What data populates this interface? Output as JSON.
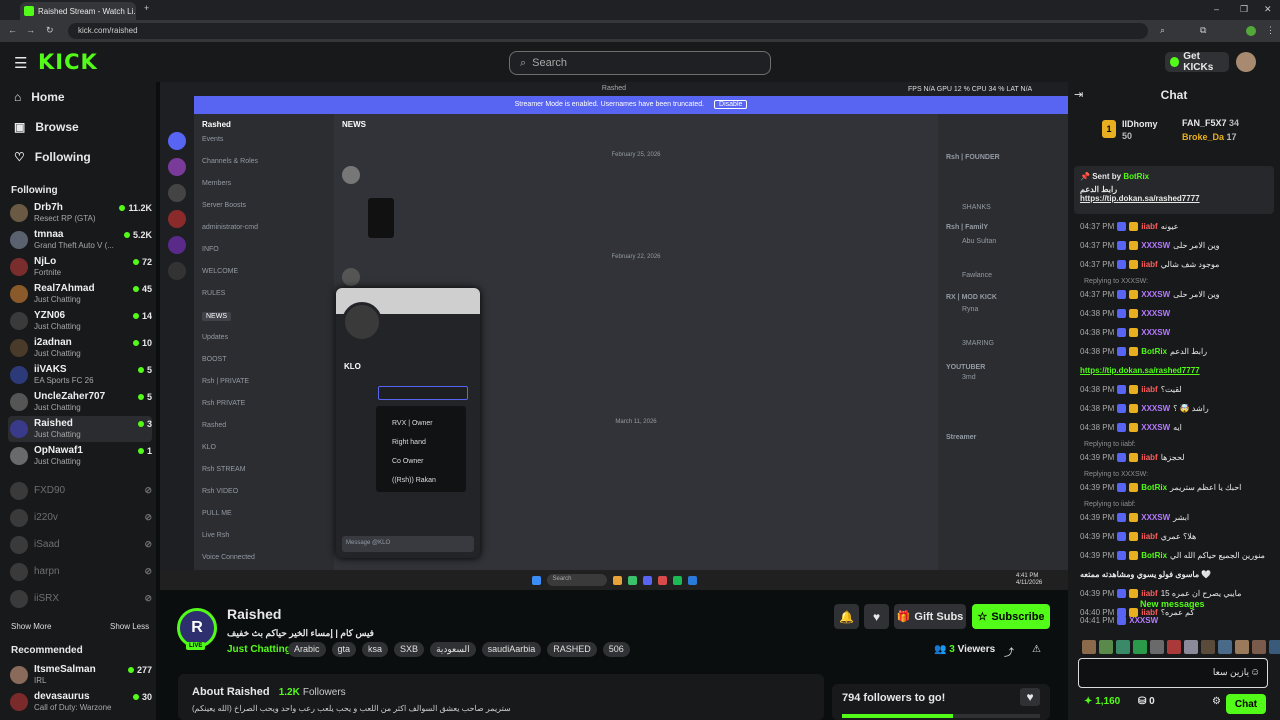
{
  "browser": {
    "tab_title": "Raished Stream - Watch Li...",
    "url": "kick.com/raished",
    "window_controls": [
      "–",
      "❐",
      "✕"
    ]
  },
  "topnav": {
    "logo": "KICK",
    "search_placeholder": "Search",
    "get_kicks": "Get KICKs"
  },
  "sidebar": {
    "nav": [
      {
        "label": "Home",
        "icon": "home-icon"
      },
      {
        "label": "Browse",
        "icon": "browse-icon"
      },
      {
        "label": "Following",
        "icon": "heart-icon"
      }
    ],
    "following_header": "Following",
    "following": [
      {
        "name": "Drb7h",
        "category": "Resect RP (GTA)",
        "viewers": "11.2K",
        "color": "#6b5a43"
      },
      {
        "name": "tmnaa",
        "category": "Grand Theft Auto V (...",
        "viewers": "5.2K",
        "color": "#5a6270"
      },
      {
        "name": "NjLo",
        "category": "Fortnite",
        "viewers": "72",
        "color": "#7a2d2d"
      },
      {
        "name": "Real7Ahmad",
        "category": "Just Chatting",
        "viewers": "45",
        "color": "#8a5a2a"
      },
      {
        "name": "YZN06",
        "category": "Just Chatting",
        "viewers": "14",
        "color": "#3a3a3a"
      },
      {
        "name": "i2adnan",
        "category": "Just Chatting",
        "viewers": "10",
        "color": "#4a3a2a"
      },
      {
        "name": "iiVAKS",
        "category": "EA Sports FC 26",
        "viewers": "5",
        "color": "#2d3a7a"
      },
      {
        "name": "UncleZaher707",
        "category": "Just Chatting",
        "viewers": "5",
        "color": "#555555"
      },
      {
        "name": "Raished",
        "category": "Just Chatting",
        "viewers": "3",
        "color": "#3a3a8a"
      },
      {
        "name": "OpNawaf1",
        "category": "Just Chatting",
        "viewers": "1",
        "color": "#6a6a6a"
      }
    ],
    "offline": [
      "FXD90",
      "i220v",
      "iSaad",
      "harpn",
      "iiSRX"
    ],
    "show_more": "Show More",
    "show_less": "Show Less",
    "recommended_header": "Recommended",
    "recommended": [
      {
        "name": "ItsmeSalman",
        "category": "IRL",
        "viewers": "277",
        "color": "#8a6a5a"
      },
      {
        "name": "devasaurus",
        "category": "Call of Duty: Warzone",
        "viewers": "30",
        "color": "#7a2a2a"
      }
    ]
  },
  "discord": {
    "banner": "Streamer Mode is enabled. Usernames have been truncated.",
    "banner_button": "Disable",
    "server_name": "Rashed",
    "header_channel": "NEWS",
    "window_title": "Rashed",
    "channels": [
      "Events",
      "Channels & Roles",
      "Members",
      "Server Boosts",
      "administrator-cmd",
      "INFO",
      "WELCOME",
      "RULES",
      "NEWS",
      "Updates",
      "BOOST",
      "Rsh | PRIVATE",
      "Rsh PRIVATE",
      "Rashed",
      "KLO",
      "Rsh STREAM",
      "Rsh VIDEO",
      "PULL ME",
      "Live Rsh",
      "Voice Connected"
    ],
    "dates": [
      "February 25, 2026",
      "February 22, 2026",
      "March 11, 2026"
    ],
    "popup_name": "KLO",
    "popup_roles": [
      "RVX | Owner",
      "Right hand",
      "Co Owner",
      "((Rsh)) Rakan"
    ],
    "message_placeholder": "Message @KLO",
    "members_groups": [
      "Rsh | FOUNDER",
      "Rsh | FamilY",
      "RX | MOD KICK",
      "YOUTUBER",
      "Streamer"
    ],
    "members": [
      "SHANKS",
      "Abu Sultan",
      "Fawlance",
      "Ryna",
      "3MARING",
      "3md"
    ],
    "stats": "FPS N/A   GPU 12 %   CPU 34 %   LAT N/A",
    "taskbar_search": "Search",
    "clock": "4:41 PM\n4/11/2026"
  },
  "stream": {
    "avatar_letter": "R",
    "live": "LIVE",
    "streamer": "Raished",
    "title": "فيس كام | إمساء الخير حياكم بث خفيف",
    "category": "Just Chatting",
    "tags": [
      "Arabic",
      "gta",
      "ksa",
      "SXB",
      "السعودية",
      "saudiAarbia",
      "RASHED",
      "506"
    ],
    "gift_subs": "Gift Subs",
    "subscribe": "Subscribe",
    "viewers_count": "3",
    "viewers_label": "Viewers",
    "about_title": "About Raished",
    "followers_count": "1.2K",
    "followers_label": "Followers",
    "about_text": "ستريمر صاحب يعشق السوالف اكثر من اللعب و يحب يلعب رعب واحد ويحب الصراخ (الله يعينكم)",
    "goal_text": "794 followers to go!",
    "goal_progress": 0.56
  },
  "chat": {
    "title": "Chat",
    "leaderboard": [
      {
        "name": "IIDhomy",
        "score": "50"
      },
      {
        "name": "FAN_F5X7",
        "score": "34"
      },
      {
        "name": "Broke_Da",
        "score": "17"
      }
    ],
    "pinned_by": "Sent by",
    "pinned_user": "BotRix",
    "pinned_text": "رابط الدعم",
    "pinned_link": "https://tip.dokan.sa/rashed7777",
    "messages": [
      {
        "time": "04:37 PM",
        "user": "iiabf",
        "color": "#ff5c5c",
        "text": "عيونه"
      },
      {
        "time": "04:37 PM",
        "user": "XXXSW",
        "color": "#b57bff",
        "text": "وين الامر حلى"
      },
      {
        "time": "04:37 PM",
        "user": "iiabf",
        "color": "#ff5c5c",
        "text": "موجود شف شالي"
      },
      {
        "time": "04:37 PM",
        "user": "XXXSW",
        "color": "#b57bff",
        "text": "وين الامر حلى"
      },
      {
        "time": "04:38 PM",
        "user": "XXXSW",
        "color": "#b57bff",
        "text": ""
      },
      {
        "time": "04:38 PM",
        "user": "XXXSW",
        "color": "#b57bff",
        "text": ""
      },
      {
        "time": "04:38 PM",
        "user": "BotRix",
        "color": "#53fc18",
        "text": "رابط الدعم"
      },
      {
        "time": "",
        "user": "",
        "color": "#53fc18",
        "text": "https://tip.dokan.sa/rashed7777"
      },
      {
        "time": "04:38 PM",
        "user": "iiabf",
        "color": "#ff5c5c",
        "text": "لقيت؟"
      },
      {
        "time": "04:38 PM",
        "user": "XXXSW",
        "color": "#b57bff",
        "text": "راشد 🤯 ؟"
      },
      {
        "time": "04:38 PM",
        "user": "XXXSW",
        "color": "#b57bff",
        "text": "ايه"
      },
      {
        "time": "04:39 PM",
        "user": "iiabf",
        "color": "#ff5c5c",
        "text": "لحجزها"
      },
      {
        "time": "04:39 PM",
        "user": "BotRix",
        "color": "#53fc18",
        "text": "احبك يا اعظم ستريمر"
      },
      {
        "time": "04:39 PM",
        "user": "XXXSW",
        "color": "#b57bff",
        "text": "ابشر"
      },
      {
        "time": "04:39 PM",
        "user": "iiabf",
        "color": "#ff5c5c",
        "text": "هلا؟ عمري"
      },
      {
        "time": "04:39 PM",
        "user": "BotRix",
        "color": "#53fc18",
        "text": "منورين الجميع حياكم الله الي"
      },
      {
        "time": "",
        "user": "",
        "color": "#e8e8e8",
        "text": "ماسوى فولو يسوي ومشاهدته ممتعه 🤍"
      },
      {
        "time": "04:39 PM",
        "user": "iiabf",
        "color": "#ff5c5c",
        "text": "مايبي يصرح ان عمره 15"
      },
      {
        "time": "04:40 PM",
        "user": "iiabf",
        "color": "#ff5c5c",
        "text": "كم عمره؟"
      }
    ],
    "replies": [
      "Replying to XXXSW:",
      "Replying to iiabf:",
      "Replying to XXXSW:",
      "Replying to iiabf:"
    ],
    "new_messages": "New messages",
    "last_message_time": "04:41 PM",
    "last_message_user": "XXXSW",
    "input_value": "يازين سعا",
    "kicks_balance": "1,160",
    "points": "0",
    "chat_button": "Chat"
  },
  "colors": {
    "accent": "#53fc18",
    "bg": "#0b0e0f",
    "panel": "#18191b",
    "discord": "#5865f2"
  }
}
